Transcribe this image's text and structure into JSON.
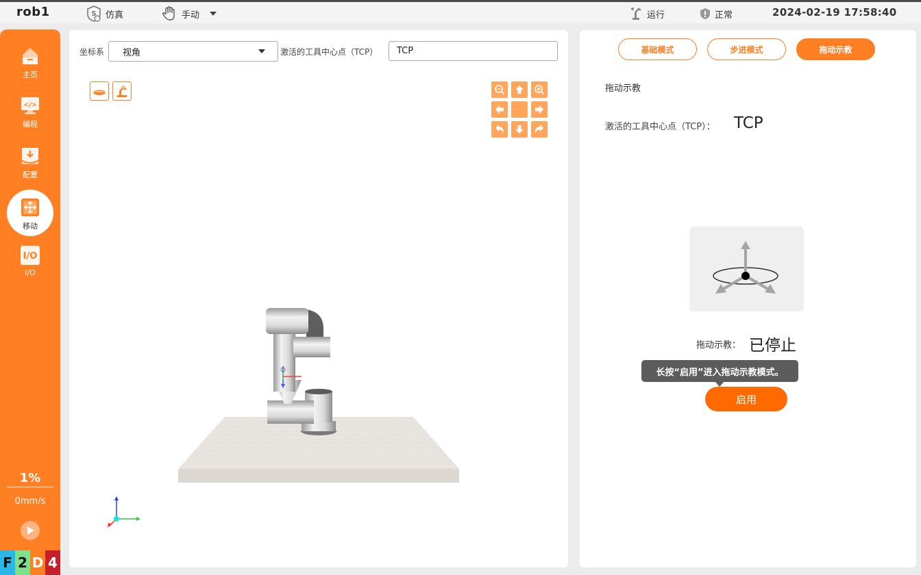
{
  "topbar": {
    "robot_name": "rob1",
    "sim_label": "仿真",
    "mode_label": "手动",
    "run_label": "运行",
    "status_label": "正常",
    "datetime": "2024-02-19 17:58:40"
  },
  "sidebar": {
    "items": [
      {
        "label": "主页",
        "icon": "home-icon"
      },
      {
        "label": "编程",
        "icon": "code-icon"
      },
      {
        "label": "配置",
        "icon": "config-icon"
      },
      {
        "label": "移动",
        "icon": "move-icon",
        "active": true
      },
      {
        "label": "I/O",
        "icon": "io-icon"
      }
    ],
    "speed_percent": "1%",
    "speed_mms": "0mm/s",
    "status_codes": [
      "F",
      "2",
      "D",
      "4"
    ],
    "status_colors": [
      "#29b6e8",
      "#7ee08a",
      "#ff7f22",
      "#c8202a"
    ]
  },
  "center": {
    "coord_label": "坐标系",
    "coord_value": "视角",
    "tcp_label": "激活的工具中心点（TCP）",
    "tcp_value": "TCP"
  },
  "right": {
    "modes": [
      "基础模式",
      "步进模式",
      "拖动示教"
    ],
    "active_mode": "拖动示教",
    "section_title": "拖动示教",
    "tcp_label": "激活的工具中心点（TCP）：",
    "tcp_value": "TCP",
    "drag_label": "拖动示教：",
    "drag_value": "已停止",
    "tooltip": "长按“启用”进入拖动示教模式。",
    "enable_label": "启用"
  },
  "colors": {
    "accent": "#ff7f22",
    "accent_dark": "#ff6a00",
    "control_button": "#ffa55c"
  }
}
